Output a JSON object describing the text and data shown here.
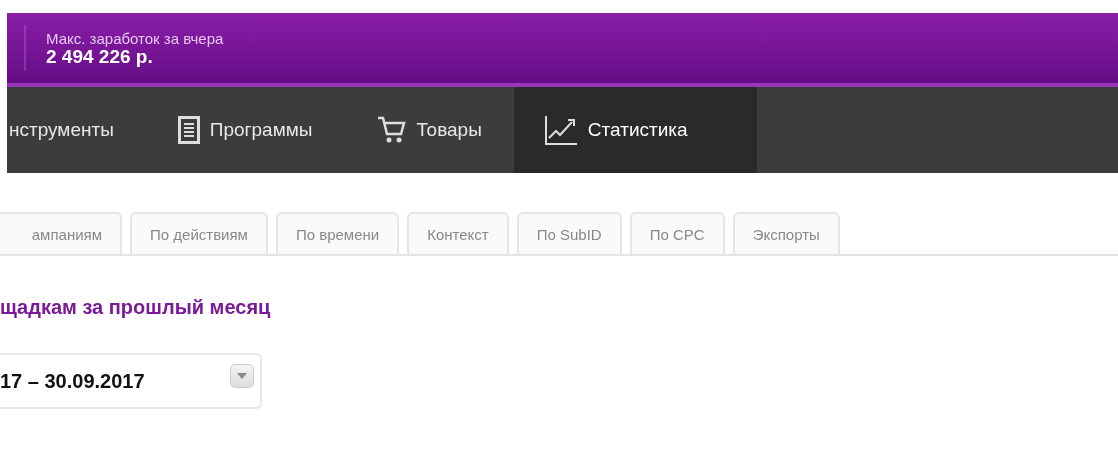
{
  "earnings": {
    "label": "Макс. заработок за вчера",
    "value": "2 494 226 р."
  },
  "nav": [
    {
      "label": "нструменты",
      "selected": false
    },
    {
      "label": "Программы",
      "selected": false
    },
    {
      "label": "Товары",
      "selected": false
    },
    {
      "label": "Статистика",
      "selected": true
    }
  ],
  "tabs": [
    {
      "label": "ампаниям",
      "selected": false
    },
    {
      "label": "По действиям",
      "selected": false
    },
    {
      "label": "По времени",
      "selected": false
    },
    {
      "label": "Контекст",
      "selected": false
    },
    {
      "label": "По SubID",
      "selected": false
    },
    {
      "label": "По CPC",
      "selected": false
    },
    {
      "label": "Экспорты",
      "selected": false
    }
  ],
  "heading": "щадкам за прошлый месяц",
  "date_range": {
    "value": "17 – 30.09.2017"
  }
}
